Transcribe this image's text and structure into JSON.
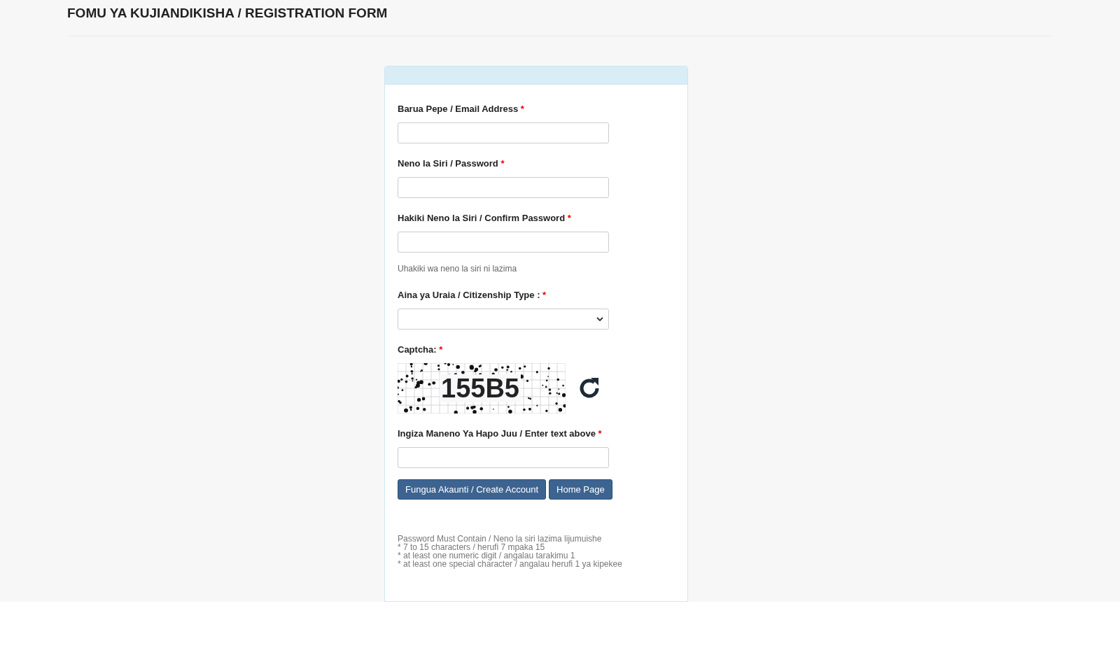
{
  "page_title": "FOMU YA KUJIANDIKISHA / REGISTRATION FORM",
  "fields": [
    {
      "kind": "input",
      "label": "Barua Pepe / Email Address",
      "required_mark": "*"
    },
    {
      "kind": "input",
      "label": "Neno la Siri / Password",
      "required_mark": "*"
    },
    {
      "kind": "input",
      "label": "Hakiki Neno la Siri / Confirm Password",
      "required_mark": "*",
      "help": "Uhakiki wa neno la siri ni lazima"
    },
    {
      "kind": "select",
      "label": "Aina ya Uraia / Citizenship Type :",
      "required_mark": "*"
    },
    {
      "kind": "captcha",
      "label": "Captcha:",
      "required_mark": "*",
      "code": "155B5"
    },
    {
      "kind": "input",
      "label": "Ingiza Maneno Ya Hapo Juu / Enter text above",
      "required_mark": "*"
    }
  ],
  "buttons": [
    "Fungua Akaunti / Create Account",
    "Home Page"
  ],
  "password_rules": [
    "Password Must Contain / Neno la siri lazima lijumuishe",
    "* 7 to 15 characters / herufi 7 mpaka 15",
    "* at least one numeric digit / angalau tarakimu 1",
    "* at least one special character / angalau herufi 1 ya kipekee"
  ]
}
